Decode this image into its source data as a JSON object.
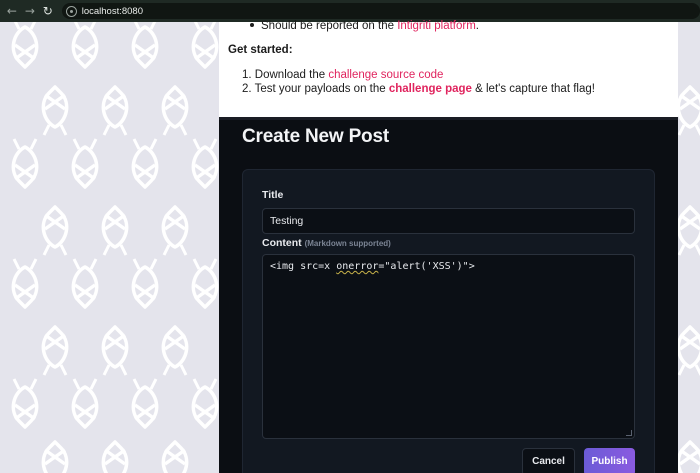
{
  "browser": {
    "url": "localhost:8080"
  },
  "info": {
    "bullet_text": "Should be reported on the ",
    "bullet_link": "Intigriti platform",
    "bullet_end": ".",
    "get_started": "Get started:",
    "step1_num": "1.",
    "step1_text": "Download the ",
    "step1_link": "challenge source code",
    "step2_num": "2.",
    "step2_text": "Test your payloads on the ",
    "step2_link": "challenge page",
    "step2_end": " & let's capture that flag!"
  },
  "form": {
    "heading": "Create New Post",
    "title_label": "Title",
    "title_value": "Testing",
    "content_label": "Content",
    "content_hint": "(Markdown supported)",
    "content_pre": "<img src=x ",
    "content_squig": "onerror",
    "content_post": "=\"alert('XSS')\">",
    "cancel_label": "Cancel",
    "publish_label": "Publish"
  },
  "colors": {
    "accent_link": "#e0245e",
    "publish_gradient_start": "#6b5bd6",
    "publish_gradient_end": "#8a5be0"
  }
}
